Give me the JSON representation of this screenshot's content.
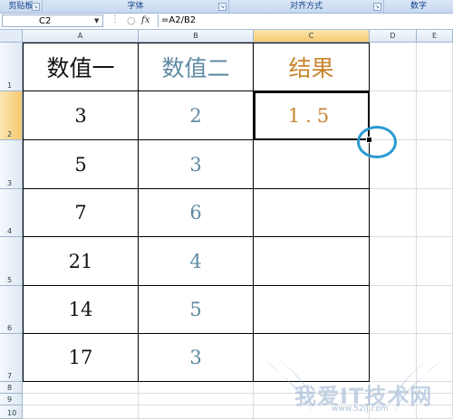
{
  "ribbon": {
    "groups": [
      "剪贴板",
      "字体",
      "对齐方式",
      "数字"
    ]
  },
  "formula_bar": {
    "name_box": "C2",
    "fx_label": "fx",
    "formula": "=A2/B2"
  },
  "columns": [
    "A",
    "B",
    "C",
    "D",
    "E"
  ],
  "rows": [
    "1",
    "2",
    "3",
    "4",
    "5",
    "6",
    "7",
    "8",
    "9",
    "10"
  ],
  "table": {
    "headers": [
      "数值一",
      "数值二",
      "结果"
    ],
    "rows": [
      [
        "3",
        "2",
        "1.5"
      ],
      [
        "5",
        "3",
        ""
      ],
      [
        "7",
        "6",
        ""
      ],
      [
        "21",
        "4",
        ""
      ],
      [
        "14",
        "5",
        ""
      ],
      [
        "17",
        "3",
        ""
      ]
    ]
  },
  "colors": {
    "value1": "#111111",
    "value2": "#5f8aa3",
    "result": "#c9852f",
    "highlight_circle": "#2a9ad0"
  },
  "watermark": {
    "text": "我爱IT技术网",
    "subtext": "www.52ij.com"
  }
}
